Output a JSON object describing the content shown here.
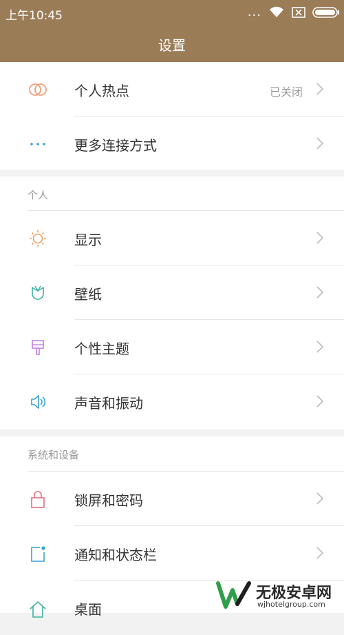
{
  "status_bar": {
    "time": "上午10:45",
    "dots": "...",
    "icons": [
      "wifi-icon",
      "sim-none-icon",
      "battery-icon"
    ]
  },
  "header": {
    "title": "设置"
  },
  "network": {
    "hotspot": {
      "label": "个人热点",
      "value": "已关闭",
      "icon": "hotspot-icon"
    },
    "more_connections": {
      "label": "更多连接方式",
      "icon": "more-dots-icon"
    }
  },
  "personal": {
    "header": "个人",
    "items": [
      {
        "label": "显示",
        "icon": "sun-icon"
      },
      {
        "label": "壁纸",
        "icon": "tulip-icon"
      },
      {
        "label": "个性主题",
        "icon": "theme-brush-icon"
      },
      {
        "label": "声音和振动",
        "icon": "speaker-icon"
      }
    ]
  },
  "system": {
    "header": "系统和设备",
    "items": [
      {
        "label": "锁屏和密码",
        "icon": "lock-icon"
      },
      {
        "label": "通知和状态栏",
        "icon": "notification-icon"
      },
      {
        "label": "桌面",
        "icon": "home-icon"
      }
    ]
  },
  "watermark": {
    "title": "无极安卓网",
    "url": "wjhotelgroup.com"
  },
  "colors": {
    "header_bg": "#9a7c57",
    "hotspot": "#f0a07a",
    "connections": "#3aa0d8",
    "display": "#f0a060",
    "wallpaper": "#3fb0a0",
    "theme": "#c080e0",
    "sound": "#3aa0d8",
    "lock": "#e07080",
    "notification": "#3aa0d8",
    "home": "#3fb0a0"
  }
}
